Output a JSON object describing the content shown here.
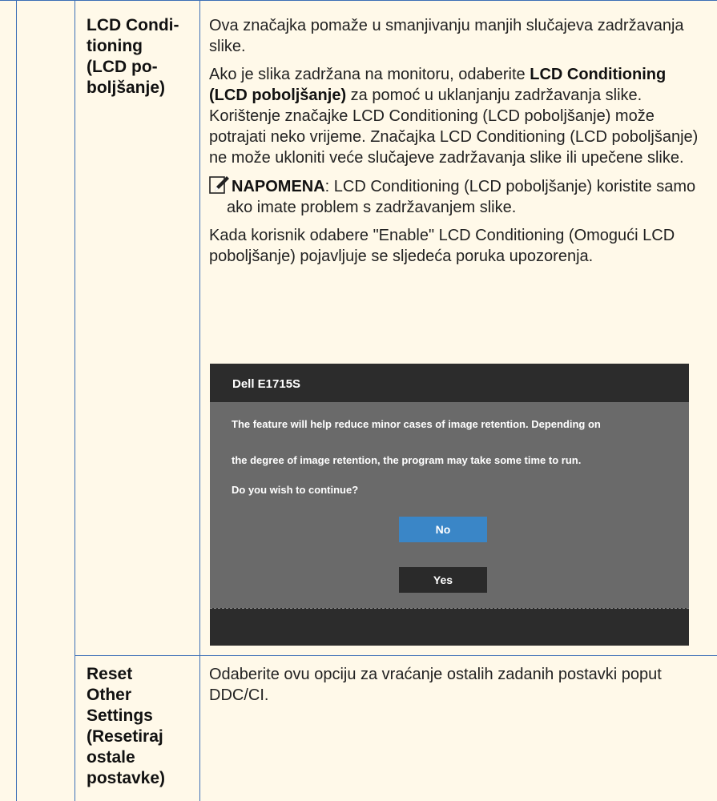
{
  "rows": [
    {
      "name_lines": [
        "LCD Condi-",
        "tioning",
        "(LCD po-",
        "boljšanje)"
      ],
      "desc": {
        "p1": "Ova značajka pomaže u smanjivanju manjih slučajeva zadržavanja slike.",
        "p2_pre": "Ako je slika zadržana na monitoru, odaberite ",
        "p2_bold": "LCD Conditioning (LCD poboljšanje)",
        "p2_post": " za pomoć u uklanjanju zadržavanja slike. Korištenje značajke LCD Conditioning (LCD poboljšanje) može potrajati neko vrijeme. Značajka LCD Conditioning (LCD poboljšanje) ne može ukloniti veće slučajeve zadržavanja slike ili upečene slike.",
        "note_label": "NAPOMENA",
        "note_text": ": LCD Conditioning (LCD poboljšanje) koristite samo ako imate problem s zadržavanjem slike.",
        "p3": "Kada korisnik odabere \"Enable\" LCD Conditioning (Omogući LCD poboljšanje) pojavljuje se sljedeća poruka upozorenja."
      }
    },
    {
      "name_lines": [
        "Reset",
        "Other",
        "Settings",
        "(Resetiraj",
        "ostale",
        "postavke)"
      ],
      "desc": {
        "p1": "Odaberite ovu opciju za vraćanje ostalih zadanih postavki poput DDC/CI."
      }
    }
  ],
  "dialog": {
    "title": "Dell E1715S",
    "line1": "The feature will help reduce minor cases of image retention. Depending on",
    "line2": "the degree of image retention, the program may take some time to run.",
    "line3": "Do you wish to continue?",
    "no_label": "No",
    "yes_label": "Yes"
  },
  "colors": {
    "background": "#fff9e9",
    "rule": "#3b6fb6",
    "dialog_title_bar": "#2c2c2c",
    "dialog_body": "#6a6a6a",
    "button_no": "#3a86c7",
    "button_yes": "#2a2a2a"
  },
  "icons": {
    "note": "pencil-note-icon"
  }
}
